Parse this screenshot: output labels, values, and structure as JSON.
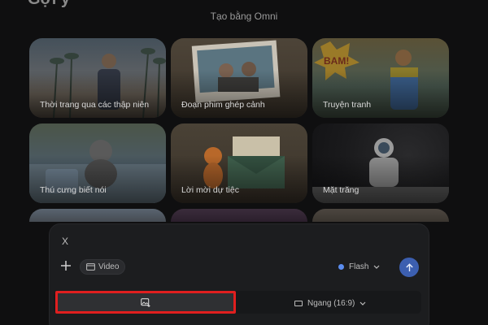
{
  "page": {
    "heading": "Gợi ý",
    "subtitle": "Tạo bằng Omni"
  },
  "cards": [
    {
      "label": "Thời trang qua các thập niên",
      "art": "art-beach"
    },
    {
      "label": "Đoạn phim ghép cảnh",
      "art": "art-photo"
    },
    {
      "label": "Truyện tranh",
      "art": "art-comic"
    },
    {
      "label": "Thú cưng biết nói",
      "art": "art-dog"
    },
    {
      "label": "Lời mời dự tiệc",
      "art": "art-fox"
    },
    {
      "label": "Mặt trăng",
      "art": "art-moon"
    },
    {
      "label": "",
      "art": "art-a"
    },
    {
      "label": "",
      "art": "art-b"
    },
    {
      "label": "",
      "art": "art-c"
    }
  ],
  "composer": {
    "close_label": "X",
    "add_icon": "plus-icon",
    "mode_chip": "Video",
    "model_label": "Flash",
    "send_icon": "arrow-up-icon",
    "image_button_icon": "image-add-icon",
    "aspect_label": "Ngang (16:9)",
    "colors": {
      "accent": "#3c5fb0",
      "model_dot": "#5b8def",
      "highlight": "#e01f1f"
    }
  }
}
